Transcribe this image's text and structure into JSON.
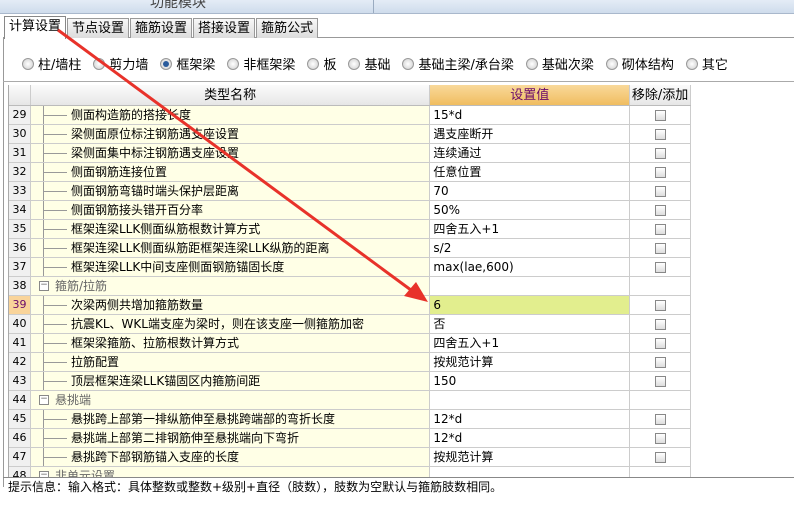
{
  "window": {
    "module_title": "功能模块"
  },
  "tabs": [
    {
      "label": "计算设置",
      "active": true
    },
    {
      "label": "节点设置"
    },
    {
      "label": "箍筋设置"
    },
    {
      "label": "搭接设置"
    },
    {
      "label": "箍筋公式"
    }
  ],
  "radios": [
    {
      "label": "柱/墙柱"
    },
    {
      "label": "剪力墙"
    },
    {
      "label": "框架梁",
      "checked": true
    },
    {
      "label": "非框架梁"
    },
    {
      "label": "板"
    },
    {
      "label": "基础"
    },
    {
      "label": "基础主梁/承台梁"
    },
    {
      "label": "基础次梁"
    },
    {
      "label": "砌体结构"
    },
    {
      "label": "其它"
    }
  ],
  "table": {
    "headers": [
      "类型名称",
      "设置值",
      "移除/添加"
    ],
    "rows": [
      {
        "n": "29",
        "name": "侧面构造筋的搭接长度",
        "value": "15*d"
      },
      {
        "n": "30",
        "name": "梁侧面原位标注钢筋遇支座设置",
        "value": "遇支座断开"
      },
      {
        "n": "31",
        "name": "梁侧面集中标注钢筋遇支座设置",
        "value": "连续通过"
      },
      {
        "n": "32",
        "name": "侧面钢筋连接位置",
        "value": "任意位置"
      },
      {
        "n": "33",
        "name": "侧面钢筋弯锚时端头保护层距离",
        "value": "70"
      },
      {
        "n": "34",
        "name": "侧面钢筋接头错开百分率",
        "value": "50%"
      },
      {
        "n": "35",
        "name": "框架连梁LLK侧面纵筋根数计算方式",
        "value": "四舍五入+1"
      },
      {
        "n": "36",
        "name": "框架连梁LLK侧面纵筋距框架连梁LLK纵筋的距离",
        "value": "s/2"
      },
      {
        "n": "37",
        "name": "框架连梁LLK中间支座侧面钢筋锚固长度",
        "value": "max(lae,600)"
      },
      {
        "n": "38",
        "name": "箍筋/拉筋",
        "value": "",
        "group": true
      },
      {
        "n": "39",
        "name": "次梁两侧共增加箍筋数量",
        "value": "6",
        "selected": true
      },
      {
        "n": "40",
        "name": "抗震KL、WKL端支座为梁时，则在该支座一侧箍筋加密",
        "value": "否"
      },
      {
        "n": "41",
        "name": "框架梁箍筋、拉筋根数计算方式",
        "value": "四舍五入+1"
      },
      {
        "n": "42",
        "name": "拉筋配置",
        "value": "按规范计算"
      },
      {
        "n": "43",
        "name": "顶层框架连梁LLK锚固区内箍筋间距",
        "value": "150"
      },
      {
        "n": "44",
        "name": "悬挑端",
        "value": "",
        "group": true
      },
      {
        "n": "45",
        "name": "悬挑跨上部第一排纵筋伸至悬挑跨端部的弯折长度",
        "value": "12*d"
      },
      {
        "n": "46",
        "name": "悬挑端上部第二排钢筋伸至悬挑端向下弯折",
        "value": "12*d"
      },
      {
        "n": "47",
        "name": "悬挑跨下部钢筋锚入支座的长度",
        "value": "按规范计算"
      },
      {
        "n": "48",
        "name": "非单元设置",
        "value": "",
        "group": true
      }
    ]
  },
  "hint": "提示信息：输入格式：具体整数或整数+级别+直径（肢数），肢数为空默认与箍筋肢数相同。",
  "colors": {
    "arrow": "#e8322a",
    "selected_value": "#e2ee8e",
    "header_value": "#f0bd60"
  }
}
